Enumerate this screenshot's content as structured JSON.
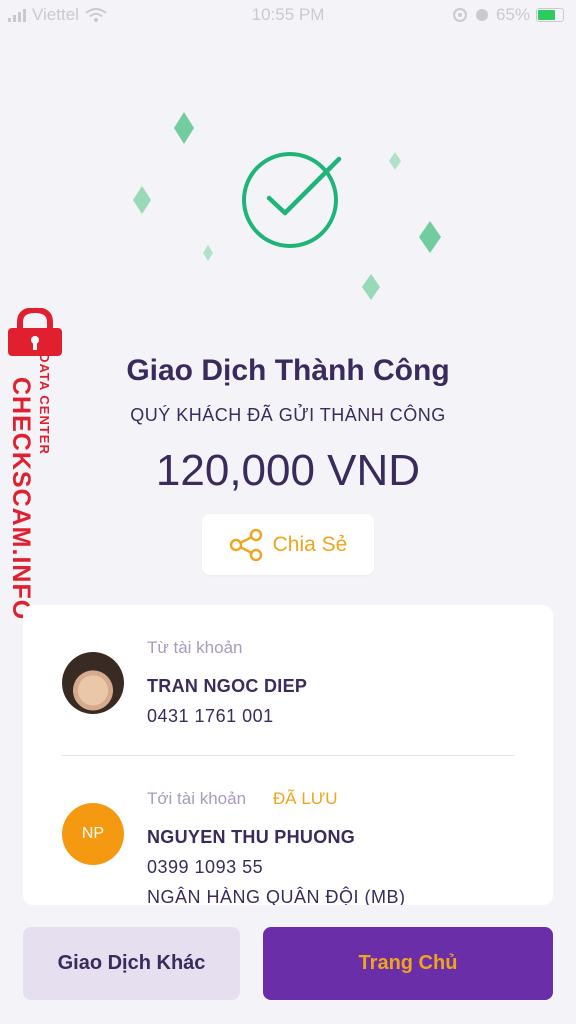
{
  "status_bar": {
    "carrier": "Viettel",
    "time": "10:55 PM",
    "battery_percent": "65%",
    "battery_level": 0.65
  },
  "watermark": {
    "main": "CHECKSCAM.INFO",
    "sub": "DATA CENTER"
  },
  "result": {
    "title": "Giao Dịch Thành Công",
    "subtitle": "QUÝ KHÁCH ĐÃ GỬI THÀNH CÔNG",
    "amount": "120,000 VND",
    "share_label": "Chia Sẻ"
  },
  "colors": {
    "success": "#1fb47a",
    "accent": "#f0a41e",
    "primary": "#6a2ea8",
    "text": "#3a2b5c"
  },
  "from_account": {
    "label": "Từ tài khoản",
    "name": "TRAN NGOC DIEP",
    "number": "0431 1761 001"
  },
  "to_account": {
    "label": "Tới tài khoản",
    "saved_badge": "ĐÃ LƯU",
    "initials": "NP",
    "name": "NGUYEN THU PHUONG",
    "number": "0399 1093 55",
    "bank": "NGÂN HÀNG QUÂN ĐỘI (MB)"
  },
  "actions": {
    "other_transaction": "Giao Dịch Khác",
    "home": "Trang Chủ"
  }
}
